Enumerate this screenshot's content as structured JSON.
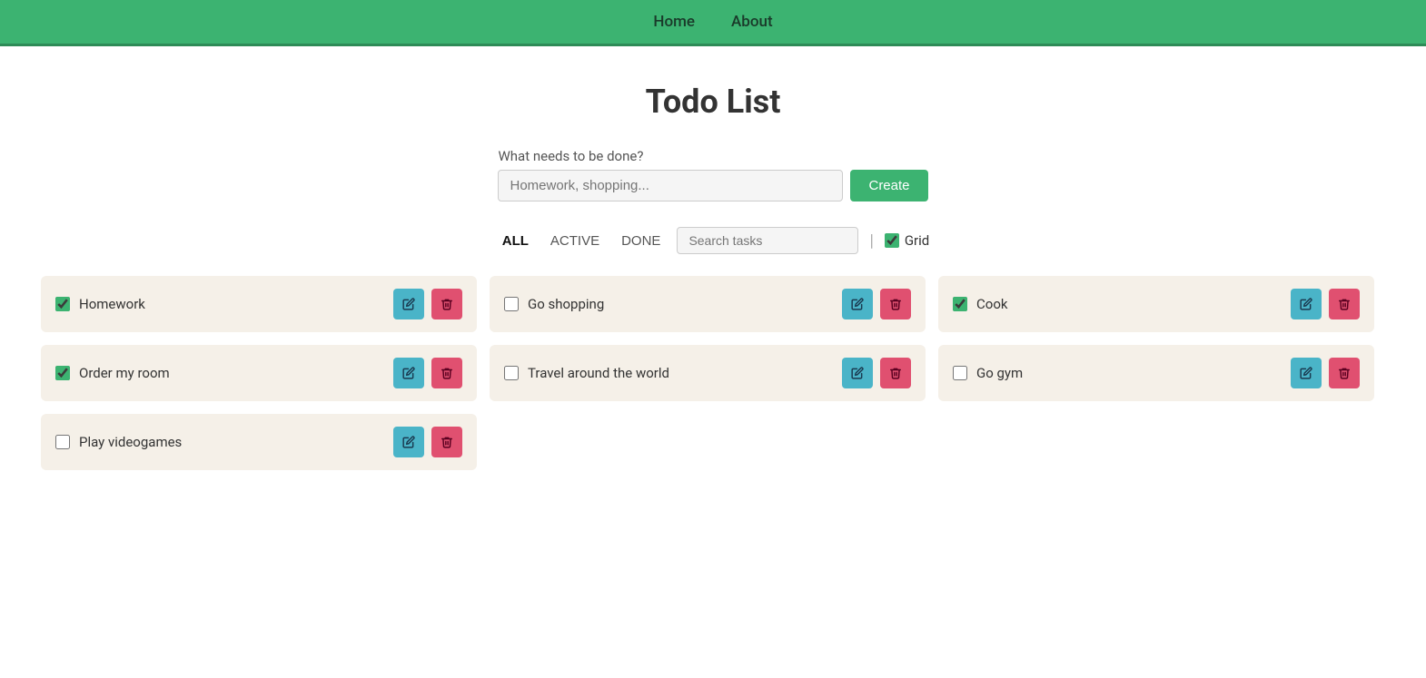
{
  "navbar": {
    "items": [
      {
        "id": "home",
        "label": "Home"
      },
      {
        "id": "about",
        "label": "About"
      }
    ]
  },
  "page": {
    "title": "Todo List"
  },
  "input": {
    "label": "What needs to be done?",
    "placeholder": "Homework, shopping...",
    "create_label": "Create"
  },
  "filters": {
    "all_label": "ALL",
    "active_label": "ACTIVE",
    "done_label": "DONE",
    "search_placeholder": "Search tasks",
    "grid_label": "Grid",
    "grid_checked": true
  },
  "tasks": [
    {
      "id": 1,
      "name": "Homework",
      "done": true,
      "col": 0
    },
    {
      "id": 2,
      "name": "Order my room",
      "done": true,
      "col": 0
    },
    {
      "id": 3,
      "name": "Play videogames",
      "done": false,
      "col": 0
    },
    {
      "id": 4,
      "name": "Go shopping",
      "done": false,
      "col": 1
    },
    {
      "id": 5,
      "name": "Travel around the world",
      "done": false,
      "col": 1
    },
    {
      "id": 6,
      "name": "Cook",
      "done": true,
      "col": 2
    },
    {
      "id": 7,
      "name": "Go gym",
      "done": false,
      "col": 2
    }
  ],
  "icons": {
    "edit": "✏️",
    "delete": "🗑"
  }
}
